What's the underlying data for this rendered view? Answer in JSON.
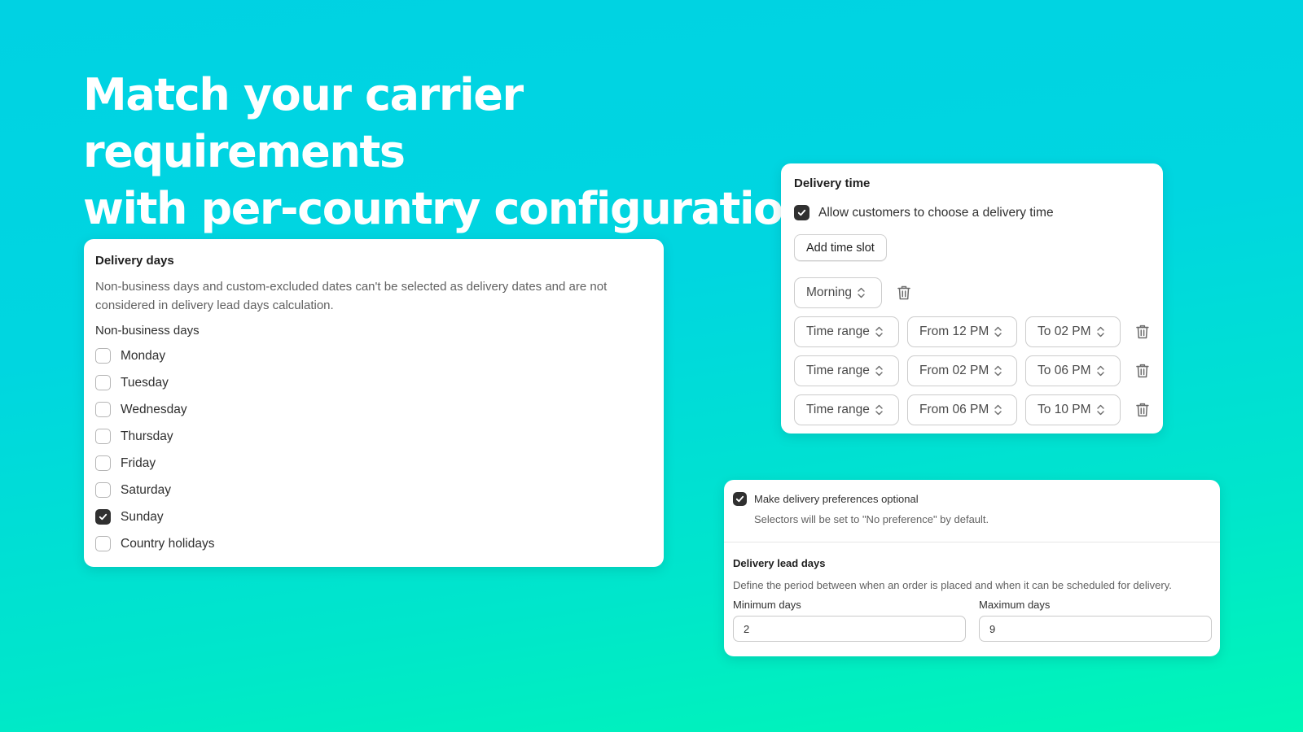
{
  "headline": {
    "line1": "Match your carrier requirements",
    "line2": "with per-country configuration"
  },
  "delivery_days": {
    "title": "Delivery days",
    "description": "Non-business days and custom-excluded dates can't be selected as delivery dates and are not considered in delivery lead days calculation.",
    "subheading": "Non-business days",
    "days": [
      {
        "label": "Monday",
        "checked": false
      },
      {
        "label": "Tuesday",
        "checked": false
      },
      {
        "label": "Wednesday",
        "checked": false
      },
      {
        "label": "Thursday",
        "checked": false
      },
      {
        "label": "Friday",
        "checked": false
      },
      {
        "label": "Saturday",
        "checked": false
      },
      {
        "label": "Sunday",
        "checked": true
      },
      {
        "label": "Country holidays",
        "checked": false
      }
    ]
  },
  "delivery_time": {
    "title": "Delivery time",
    "allow_choice": {
      "label": "Allow customers to choose a delivery time",
      "checked": true
    },
    "add_slot_label": "Add time slot",
    "slots": [
      {
        "type": "Morning"
      },
      {
        "type": "Time range",
        "from": "From 12 PM",
        "to": "To 02 PM"
      },
      {
        "type": "Time range",
        "from": "From 02 PM",
        "to": "To 06 PM"
      },
      {
        "type": "Time range",
        "from": "From 06 PM",
        "to": "To 10 PM"
      }
    ]
  },
  "preferences": {
    "optional": {
      "label": "Make delivery preferences optional",
      "checked": true
    },
    "help": "Selectors will be set to \"No preference\" by default."
  },
  "lead_days": {
    "title": "Delivery lead days",
    "description": "Define the period between when an order is placed and when it can be scheduled for delivery.",
    "min_label": "Minimum days",
    "min_value": "2",
    "max_label": "Maximum days",
    "max_value": "9"
  },
  "colors": {
    "background_top": "#00d2e3",
    "background_bottom": "#00f7b6",
    "checkbox_checked": "#303030"
  }
}
